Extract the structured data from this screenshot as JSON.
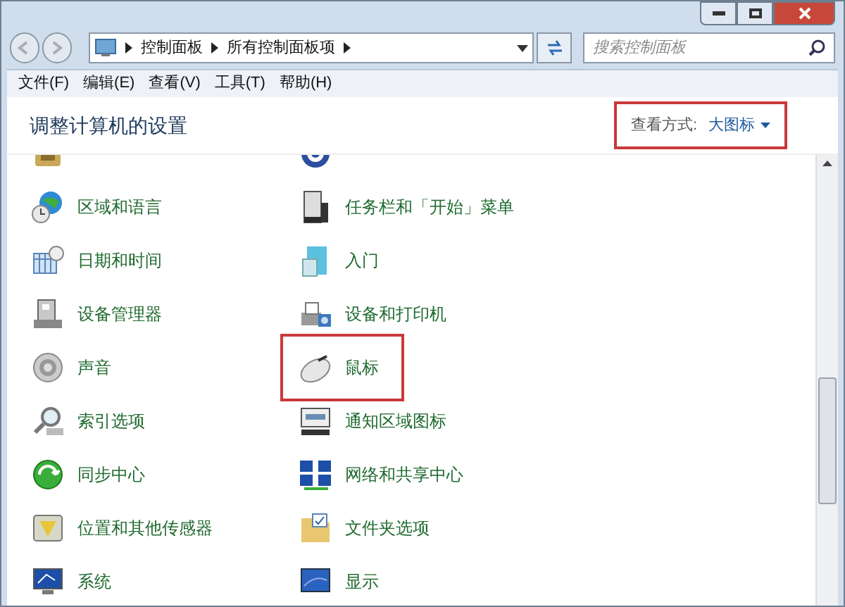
{
  "address_bar": {
    "path": [
      "控制面板",
      "所有控制面板项"
    ]
  },
  "search": {
    "placeholder": "搜索控制面板"
  },
  "menu": [
    "文件(F)",
    "编辑(E)",
    "查看(V)",
    "工具(T)",
    "帮助(H)"
  ],
  "heading": "调整计算机的设置",
  "view_by": {
    "label": "查看方式:",
    "value": "大图标",
    "highlighted": true
  },
  "items": [
    {
      "highlighted": false
    },
    {
      "highlighted": false
    },
    {
      "label": "区域和语言",
      "highlighted": false
    },
    {
      "label": "任务栏和「开始」菜单",
      "highlighted": false
    },
    {
      "label": "日期和时间",
      "highlighted": false
    },
    {
      "label": "入门",
      "highlighted": false
    },
    {
      "label": "设备管理器",
      "highlighted": false
    },
    {
      "label": "设备和打印机",
      "highlighted": false
    },
    {
      "label": "声音",
      "highlighted": false
    },
    {
      "label": "鼠标",
      "highlighted": true
    },
    {
      "label": "索引选项",
      "highlighted": false
    },
    {
      "label": "通知区域图标",
      "highlighted": false
    },
    {
      "label": "同步中心",
      "highlighted": false
    },
    {
      "label": "网络和共享中心",
      "highlighted": false
    },
    {
      "label": "位置和其他传感器",
      "highlighted": false
    },
    {
      "label": "文件夹选项",
      "highlighted": false
    },
    {
      "label": "系统",
      "highlighted": false
    },
    {
      "label": "显示",
      "highlighted": false
    }
  ]
}
